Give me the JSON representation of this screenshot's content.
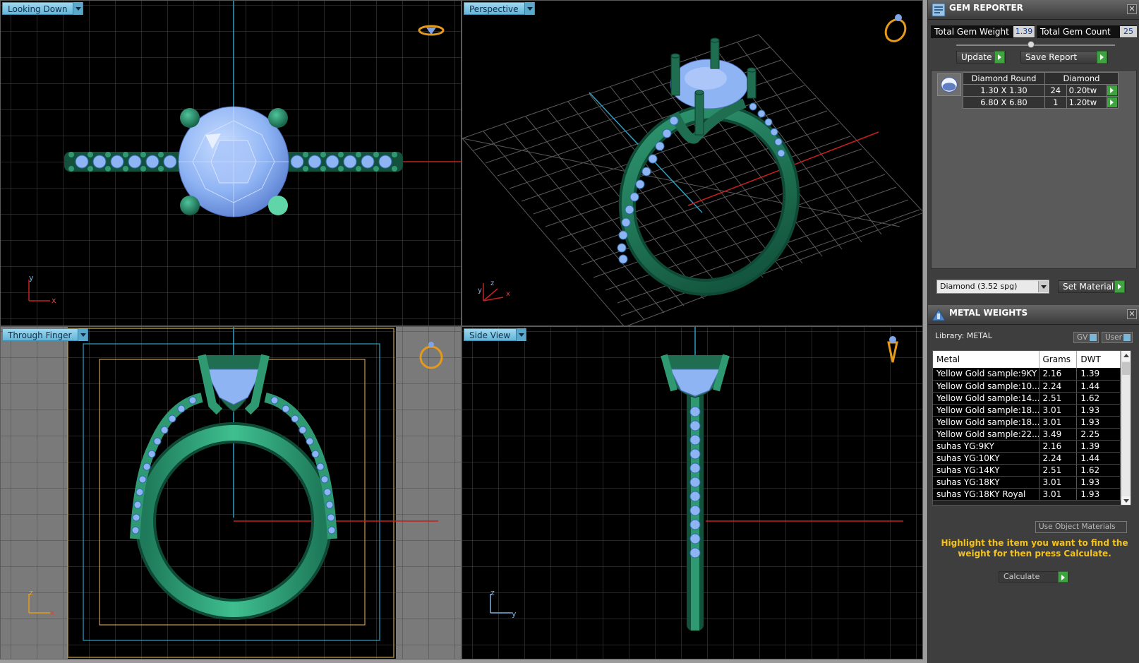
{
  "viewports": {
    "top_left": {
      "label": "Looking Down"
    },
    "top_right": {
      "label": "Perspective"
    },
    "bottom_left": {
      "label": "Through Finger"
    },
    "bottom_right": {
      "label": "Side View"
    }
  },
  "axes": {
    "top_left": [
      "y",
      "x"
    ],
    "top_right": [
      "z",
      "y",
      "x"
    ],
    "bottom_left": [
      "z",
      "x"
    ],
    "bottom_right": [
      "z",
      "y"
    ]
  },
  "gem_reporter": {
    "title": "GEM REPORTER",
    "total_weight_label": "Total Gem Weight",
    "total_weight_value": "1.39",
    "total_count_label": "Total Gem Count",
    "total_count_value": "25",
    "update_label": "Update",
    "save_report_label": "Save Report",
    "table": {
      "header": [
        "Diamond Round",
        "Diamond"
      ],
      "rows": [
        {
          "size": "1.30 X 1.30",
          "count": "24",
          "weight": "0.20tw"
        },
        {
          "size": "6.80 X 6.80",
          "count": "1",
          "weight": "1.20tw"
        }
      ]
    },
    "material_select": "Diamond    (3.52 spg)",
    "set_material_label": "Set Material"
  },
  "metal_weights": {
    "title": "METAL WEIGHTS",
    "library_label": "Library: METAL",
    "gv_label": "GV",
    "user_label": "User",
    "columns": [
      "Metal",
      "Grams",
      "DWT"
    ],
    "rows": [
      {
        "metal": "Yellow Gold sample:9KY",
        "grams": "2.16",
        "dwt": "1.39"
      },
      {
        "metal": "Yellow Gold sample:10...",
        "grams": "2.24",
        "dwt": "1.44"
      },
      {
        "metal": "Yellow Gold sample:14...",
        "grams": "2.51",
        "dwt": "1.62"
      },
      {
        "metal": "Yellow Gold sample:18...",
        "grams": "3.01",
        "dwt": "1.93"
      },
      {
        "metal": "Yellow Gold sample:18...",
        "grams": "3.01",
        "dwt": "1.93"
      },
      {
        "metal": "Yellow Gold sample:22...",
        "grams": "3.49",
        "dwt": "2.25"
      },
      {
        "metal": "suhas YG:9KY",
        "grams": "2.16",
        "dwt": "1.39"
      },
      {
        "metal": "suhas YG:10KY",
        "grams": "2.24",
        "dwt": "1.44"
      },
      {
        "metal": "suhas YG:14KY",
        "grams": "2.51",
        "dwt": "1.62"
      },
      {
        "metal": "suhas YG:18KY",
        "grams": "3.01",
        "dwt": "1.93"
      },
      {
        "metal": "suhas YG:18KY Royal",
        "grams": "3.01",
        "dwt": "1.93"
      }
    ],
    "use_object_materials_label": "Use Object Materials",
    "hint": "Highlight the item you want to find the weight for then press Calculate.",
    "calculate_label": "Calculate"
  },
  "colors": {
    "metal": "#1f6e52",
    "metal_light": "#2f9a72",
    "gem": "#8fb4f4",
    "grid": "#4a4a4a",
    "axis_blue": "#2f9fc4",
    "axis_red": "#c62020",
    "hint": "#f4c21d"
  }
}
